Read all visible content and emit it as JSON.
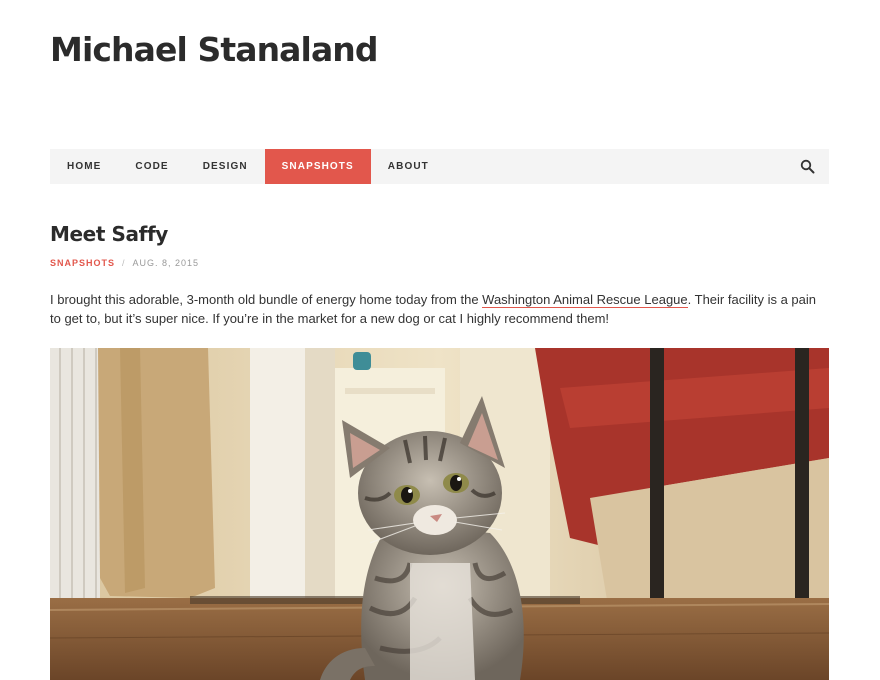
{
  "site": {
    "title": "Michael Stanaland"
  },
  "nav": {
    "items": [
      {
        "label": "HOME"
      },
      {
        "label": "CODE"
      },
      {
        "label": "DESIGN"
      },
      {
        "label": "SNAPSHOTS",
        "active": true
      },
      {
        "label": "ABOUT"
      }
    ],
    "search_icon": "search-icon"
  },
  "post": {
    "title": "Meet Saffy",
    "category": "SNAPSHOTS",
    "separator": "/",
    "date": "AUG. 8, 2015",
    "body_before": "I brought this adorable, 3-month old bundle of energy home today from the ",
    "link_text": "Washington Animal Rescue League",
    "body_after": ". Their facility is a pain to get to, but it’s super nice. If you’re in the market for a new dog or cat I highly recommend them!",
    "image": "kitten-photo"
  },
  "colors": {
    "accent": "#e2574c",
    "nav_bg": "#f4f4f4",
    "text": "#333333"
  }
}
